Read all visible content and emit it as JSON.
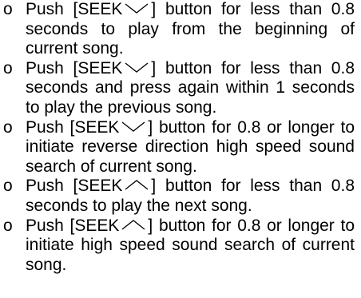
{
  "bullet_symbol": "o",
  "items": [
    {
      "before": "Push [SEEK",
      "icon": "chevron-down-icon",
      "after": "] button for less than 0.8 seconds to play from the beginning of current song."
    },
    {
      "before": "Push [SEEK",
      "icon": "chevron-down-icon",
      "after": "] button for less than 0.8 seconds and press again within 1 seconds to play the previous song."
    },
    {
      "before": "Push [SEEK",
      "icon": "chevron-down-icon",
      "after": "] button for 0.8 or longer to initiate reverse direction high speed sound search of current song."
    },
    {
      "before": "Push [SEEK",
      "icon": "chevron-up-icon",
      "after": "] button for less than 0.8 seconds to play the next song."
    },
    {
      "before": "Push [SEEK",
      "icon": "chevron-up-icon",
      "after": "] button for 0.8 or longer to initiate high speed sound search of current song."
    }
  ]
}
